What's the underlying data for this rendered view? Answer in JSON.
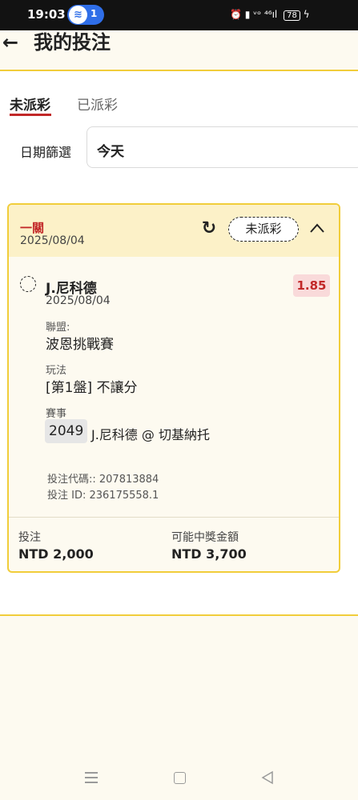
{
  "status_bar": {
    "time": "19:03",
    "notification_count": "1",
    "indicators": "⏰ ▮ ᵛᵒ ⁴⁶ıl",
    "battery": "78"
  },
  "header": {
    "back_icon": "←",
    "title": "我的投注"
  },
  "tabs": [
    {
      "label": "未派彩",
      "active": true
    },
    {
      "label": "已派彩",
      "active": false
    }
  ],
  "date_filter": {
    "label": "日期篩選",
    "value": "今天"
  },
  "bet_card": {
    "kind": "一關",
    "date": "2025/08/04",
    "status": "未派彩",
    "selection": {
      "player": "J.尼科德",
      "date": "2025/08/04",
      "odds": "1.85",
      "league_label": "聯盟:",
      "league": "波恩挑戰賽",
      "market_label": "玩法",
      "market": "[第1盤] 不讓分",
      "event_label": "賽事",
      "event_id": "2049",
      "event_name": "J.尼科德 @ 切基納托"
    },
    "bet_code": "投注代碼:: 207813884",
    "bet_id": "投注 ID: 236175558.1",
    "stake_label": "投注",
    "stake_value": "NTD 2,000",
    "payout_label": "可能中獎金額",
    "payout_value": "NTD 3,700"
  },
  "colors": {
    "accent_red": "#c22828",
    "accent_yellow": "#f1cd3a",
    "card_header_bg": "#fcf1c8"
  }
}
